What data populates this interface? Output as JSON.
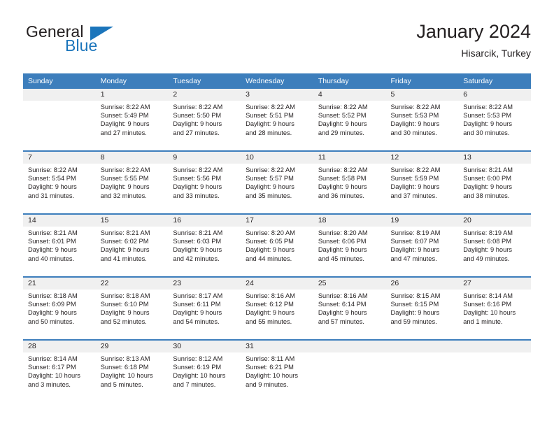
{
  "brand": {
    "name_part1": "General",
    "name_part2": "Blue",
    "logo_icon": "triangle-logo-icon"
  },
  "header": {
    "title": "January 2024",
    "subtitle": "Hisarcik, Turkey"
  },
  "colors": {
    "header_blue": "#3d7ebc",
    "brand_blue": "#1b75bb",
    "daynum_band": "#f0f0f0",
    "text": "#231f20"
  },
  "calendar": {
    "weekday_headers": [
      "Sunday",
      "Monday",
      "Tuesday",
      "Wednesday",
      "Thursday",
      "Friday",
      "Saturday"
    ],
    "weeks": [
      [
        {
          "day": "",
          "sunrise": "",
          "sunset": "",
          "daylight_line1": "",
          "daylight_line2": ""
        },
        {
          "day": "1",
          "sunrise": "Sunrise: 8:22 AM",
          "sunset": "Sunset: 5:49 PM",
          "daylight_line1": "Daylight: 9 hours",
          "daylight_line2": "and 27 minutes."
        },
        {
          "day": "2",
          "sunrise": "Sunrise: 8:22 AM",
          "sunset": "Sunset: 5:50 PM",
          "daylight_line1": "Daylight: 9 hours",
          "daylight_line2": "and 27 minutes."
        },
        {
          "day": "3",
          "sunrise": "Sunrise: 8:22 AM",
          "sunset": "Sunset: 5:51 PM",
          "daylight_line1": "Daylight: 9 hours",
          "daylight_line2": "and 28 minutes."
        },
        {
          "day": "4",
          "sunrise": "Sunrise: 8:22 AM",
          "sunset": "Sunset: 5:52 PM",
          "daylight_line1": "Daylight: 9 hours",
          "daylight_line2": "and 29 minutes."
        },
        {
          "day": "5",
          "sunrise": "Sunrise: 8:22 AM",
          "sunset": "Sunset: 5:53 PM",
          "daylight_line1": "Daylight: 9 hours",
          "daylight_line2": "and 30 minutes."
        },
        {
          "day": "6",
          "sunrise": "Sunrise: 8:22 AM",
          "sunset": "Sunset: 5:53 PM",
          "daylight_line1": "Daylight: 9 hours",
          "daylight_line2": "and 30 minutes."
        }
      ],
      [
        {
          "day": "7",
          "sunrise": "Sunrise: 8:22 AM",
          "sunset": "Sunset: 5:54 PM",
          "daylight_line1": "Daylight: 9 hours",
          "daylight_line2": "and 31 minutes."
        },
        {
          "day": "8",
          "sunrise": "Sunrise: 8:22 AM",
          "sunset": "Sunset: 5:55 PM",
          "daylight_line1": "Daylight: 9 hours",
          "daylight_line2": "and 32 minutes."
        },
        {
          "day": "9",
          "sunrise": "Sunrise: 8:22 AM",
          "sunset": "Sunset: 5:56 PM",
          "daylight_line1": "Daylight: 9 hours",
          "daylight_line2": "and 33 minutes."
        },
        {
          "day": "10",
          "sunrise": "Sunrise: 8:22 AM",
          "sunset": "Sunset: 5:57 PM",
          "daylight_line1": "Daylight: 9 hours",
          "daylight_line2": "and 35 minutes."
        },
        {
          "day": "11",
          "sunrise": "Sunrise: 8:22 AM",
          "sunset": "Sunset: 5:58 PM",
          "daylight_line1": "Daylight: 9 hours",
          "daylight_line2": "and 36 minutes."
        },
        {
          "day": "12",
          "sunrise": "Sunrise: 8:22 AM",
          "sunset": "Sunset: 5:59 PM",
          "daylight_line1": "Daylight: 9 hours",
          "daylight_line2": "and 37 minutes."
        },
        {
          "day": "13",
          "sunrise": "Sunrise: 8:21 AM",
          "sunset": "Sunset: 6:00 PM",
          "daylight_line1": "Daylight: 9 hours",
          "daylight_line2": "and 38 minutes."
        }
      ],
      [
        {
          "day": "14",
          "sunrise": "Sunrise: 8:21 AM",
          "sunset": "Sunset: 6:01 PM",
          "daylight_line1": "Daylight: 9 hours",
          "daylight_line2": "and 40 minutes."
        },
        {
          "day": "15",
          "sunrise": "Sunrise: 8:21 AM",
          "sunset": "Sunset: 6:02 PM",
          "daylight_line1": "Daylight: 9 hours",
          "daylight_line2": "and 41 minutes."
        },
        {
          "day": "16",
          "sunrise": "Sunrise: 8:21 AM",
          "sunset": "Sunset: 6:03 PM",
          "daylight_line1": "Daylight: 9 hours",
          "daylight_line2": "and 42 minutes."
        },
        {
          "day": "17",
          "sunrise": "Sunrise: 8:20 AM",
          "sunset": "Sunset: 6:05 PM",
          "daylight_line1": "Daylight: 9 hours",
          "daylight_line2": "and 44 minutes."
        },
        {
          "day": "18",
          "sunrise": "Sunrise: 8:20 AM",
          "sunset": "Sunset: 6:06 PM",
          "daylight_line1": "Daylight: 9 hours",
          "daylight_line2": "and 45 minutes."
        },
        {
          "day": "19",
          "sunrise": "Sunrise: 8:19 AM",
          "sunset": "Sunset: 6:07 PM",
          "daylight_line1": "Daylight: 9 hours",
          "daylight_line2": "and 47 minutes."
        },
        {
          "day": "20",
          "sunrise": "Sunrise: 8:19 AM",
          "sunset": "Sunset: 6:08 PM",
          "daylight_line1": "Daylight: 9 hours",
          "daylight_line2": "and 49 minutes."
        }
      ],
      [
        {
          "day": "21",
          "sunrise": "Sunrise: 8:18 AM",
          "sunset": "Sunset: 6:09 PM",
          "daylight_line1": "Daylight: 9 hours",
          "daylight_line2": "and 50 minutes."
        },
        {
          "day": "22",
          "sunrise": "Sunrise: 8:18 AM",
          "sunset": "Sunset: 6:10 PM",
          "daylight_line1": "Daylight: 9 hours",
          "daylight_line2": "and 52 minutes."
        },
        {
          "day": "23",
          "sunrise": "Sunrise: 8:17 AM",
          "sunset": "Sunset: 6:11 PM",
          "daylight_line1": "Daylight: 9 hours",
          "daylight_line2": "and 54 minutes."
        },
        {
          "day": "24",
          "sunrise": "Sunrise: 8:16 AM",
          "sunset": "Sunset: 6:12 PM",
          "daylight_line1": "Daylight: 9 hours",
          "daylight_line2": "and 55 minutes."
        },
        {
          "day": "25",
          "sunrise": "Sunrise: 8:16 AM",
          "sunset": "Sunset: 6:14 PM",
          "daylight_line1": "Daylight: 9 hours",
          "daylight_line2": "and 57 minutes."
        },
        {
          "day": "26",
          "sunrise": "Sunrise: 8:15 AM",
          "sunset": "Sunset: 6:15 PM",
          "daylight_line1": "Daylight: 9 hours",
          "daylight_line2": "and 59 minutes."
        },
        {
          "day": "27",
          "sunrise": "Sunrise: 8:14 AM",
          "sunset": "Sunset: 6:16 PM",
          "daylight_line1": "Daylight: 10 hours",
          "daylight_line2": "and 1 minute."
        }
      ],
      [
        {
          "day": "28",
          "sunrise": "Sunrise: 8:14 AM",
          "sunset": "Sunset: 6:17 PM",
          "daylight_line1": "Daylight: 10 hours",
          "daylight_line2": "and 3 minutes."
        },
        {
          "day": "29",
          "sunrise": "Sunrise: 8:13 AM",
          "sunset": "Sunset: 6:18 PM",
          "daylight_line1": "Daylight: 10 hours",
          "daylight_line2": "and 5 minutes."
        },
        {
          "day": "30",
          "sunrise": "Sunrise: 8:12 AM",
          "sunset": "Sunset: 6:19 PM",
          "daylight_line1": "Daylight: 10 hours",
          "daylight_line2": "and 7 minutes."
        },
        {
          "day": "31",
          "sunrise": "Sunrise: 8:11 AM",
          "sunset": "Sunset: 6:21 PM",
          "daylight_line1": "Daylight: 10 hours",
          "daylight_line2": "and 9 minutes."
        },
        {
          "day": "",
          "sunrise": "",
          "sunset": "",
          "daylight_line1": "",
          "daylight_line2": ""
        },
        {
          "day": "",
          "sunrise": "",
          "sunset": "",
          "daylight_line1": "",
          "daylight_line2": ""
        },
        {
          "day": "",
          "sunrise": "",
          "sunset": "",
          "daylight_line1": "",
          "daylight_line2": ""
        }
      ]
    ]
  }
}
